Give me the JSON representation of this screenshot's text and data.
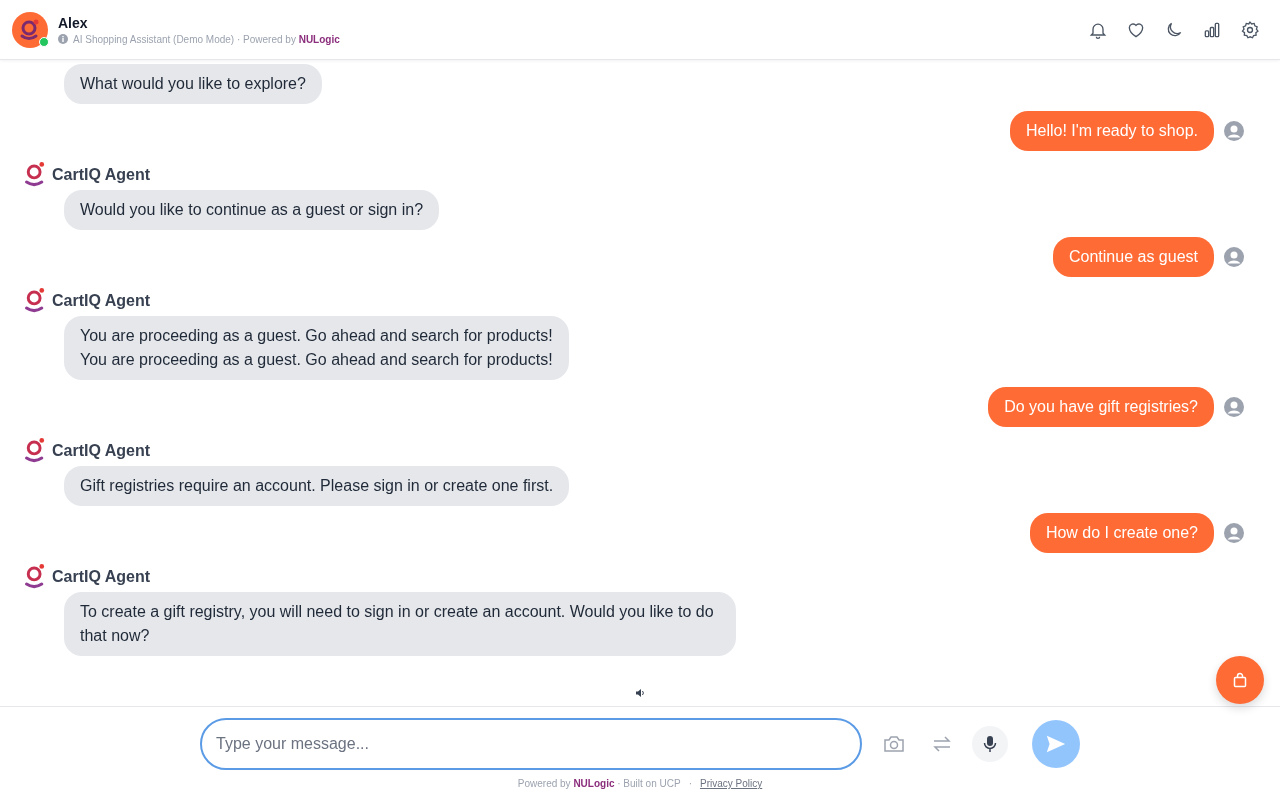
{
  "header": {
    "name": "Alex",
    "online": true,
    "subtitle": "AI Shopping Assistant (Demo Mode) · Powered by **NULogic**"
  },
  "messages": [
    {
      "kind": "agent",
      "text": "What would you like to explore?"
    },
    {
      "kind": "user",
      "text": "Hello! I'm ready to shop."
    },
    {
      "kind": "agent",
      "sender": "CartIQ Agent",
      "text": "Would you like to continue as a guest or sign in?"
    },
    {
      "kind": "user",
      "text": "Continue as guest"
    },
    {
      "kind": "agent",
      "sender": "CartIQ Agent",
      "text": "You are proceeding as a guest. Go ahead and search for products!\nYou are proceeding as a guest. Go ahead and search for products!"
    },
    {
      "kind": "user",
      "text": "Do you have gift registries?"
    },
    {
      "kind": "agent",
      "sender": "CartIQ Agent",
      "text": "Gift registries require an account. Please sign in or create one first."
    },
    {
      "kind": "user",
      "text": "How do I create one?"
    },
    {
      "kind": "agent",
      "sender": "CartIQ Agent",
      "text": "To create a gift registry, you will need to sign in or create an account. Would you like to do that now?"
    }
  ],
  "composer": {
    "placeholder": "Type your message...",
    "send_enabled": false
  },
  "footer": {
    "text": "Powered by **NULogic** · Built on UCP",
    "separator": "·",
    "link": "Privacy Policy"
  }
}
